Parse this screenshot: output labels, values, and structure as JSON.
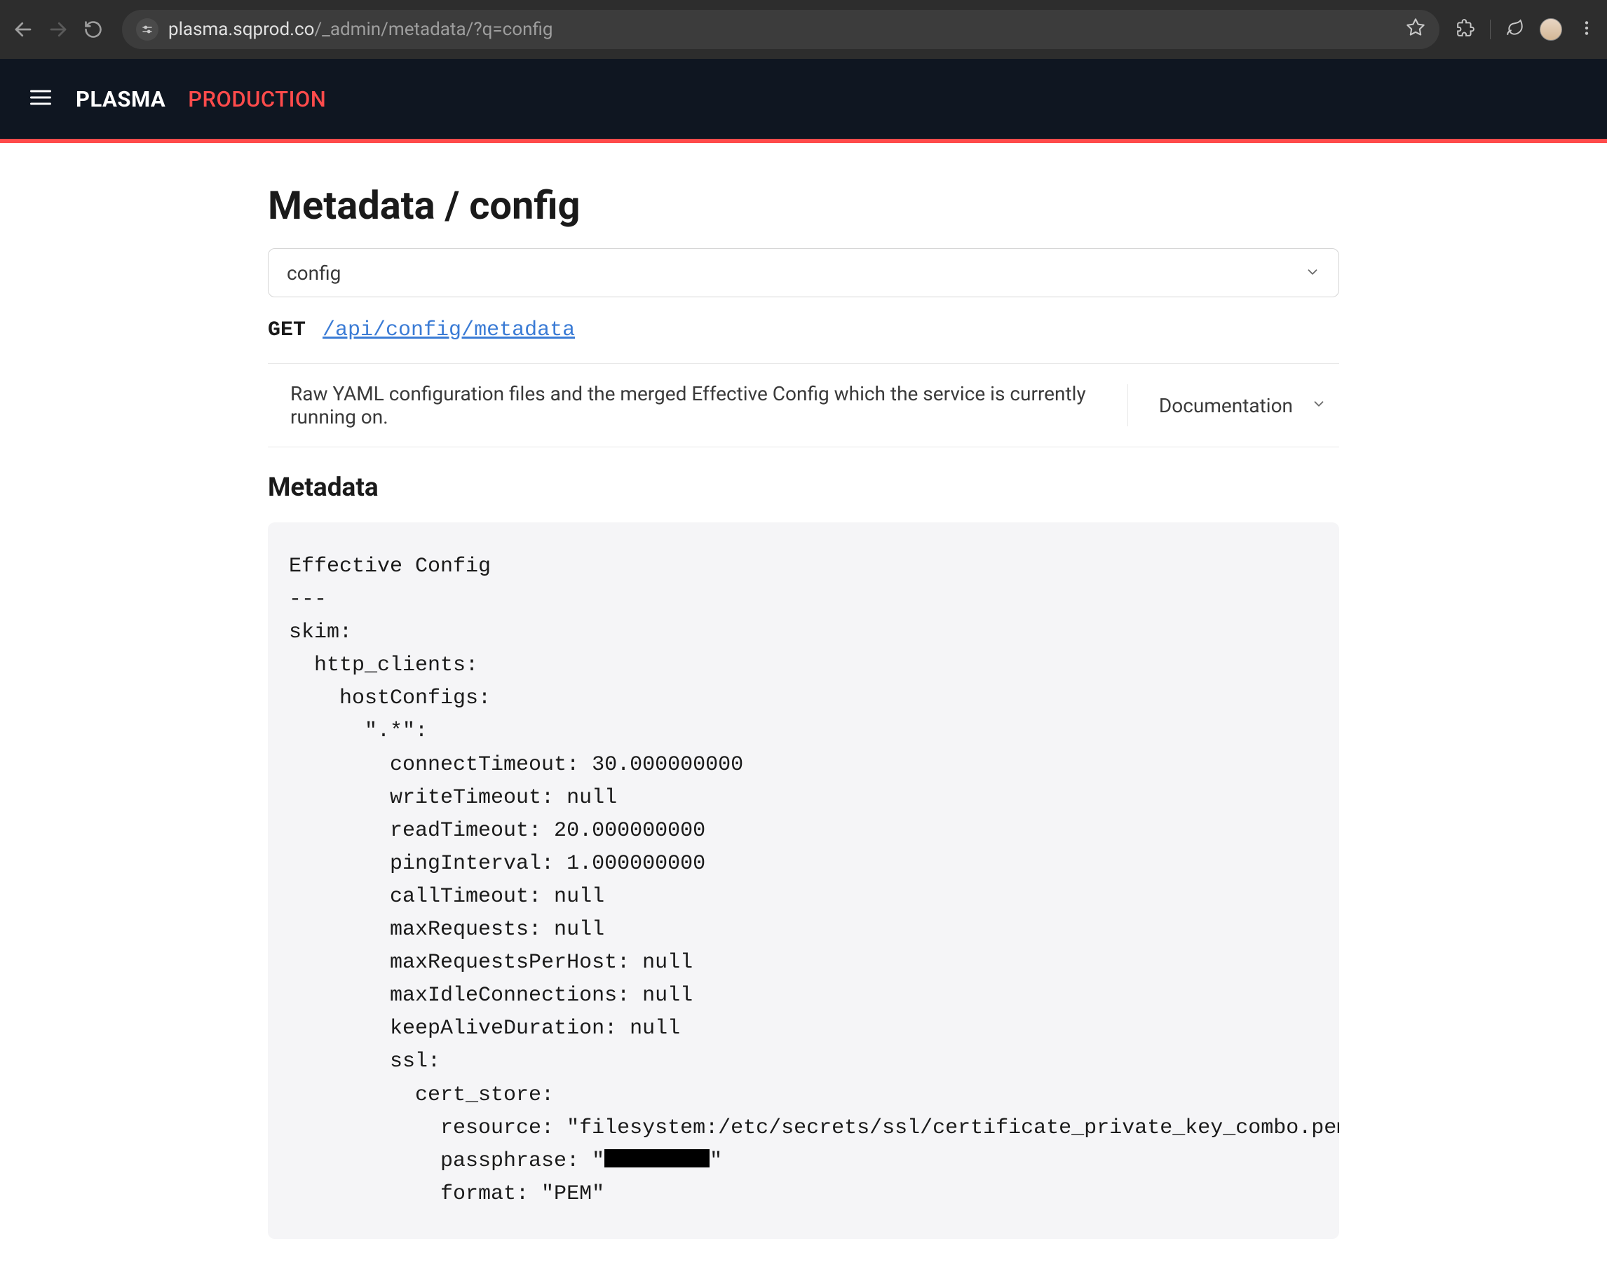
{
  "browser": {
    "url_host": "plasma.sqprod.co",
    "url_path": "/_admin/metadata/?q=config"
  },
  "header": {
    "app_name": "PLASMA",
    "environment": "PRODUCTION"
  },
  "page": {
    "title": "Metadata / config",
    "select_value": "config",
    "api_method": "GET",
    "api_path": "/api/config/metadata",
    "description": "Raw YAML configuration files and the merged Effective Config which the service is currently running on.",
    "doc_label": "Documentation",
    "section_title": "Metadata",
    "code_prefix": "Effective Config\n---\nskim:\n  http_clients:\n    hostConfigs:\n      \".*\":\n        connectTimeout: 30.000000000\n        writeTimeout: null\n        readTimeout: 20.000000000\n        pingInterval: 1.000000000\n        callTimeout: null\n        maxRequests: null\n        maxRequestsPerHost: null\n        maxIdleConnections: null\n        keepAliveDuration: null\n        ssl:\n          cert_store:\n            resource: \"filesystem:/etc/secrets/ssl/certificate_private_key_combo.pem\"\n            passphrase: \"",
    "code_suffix": "\"\n            format: \"PEM\""
  }
}
